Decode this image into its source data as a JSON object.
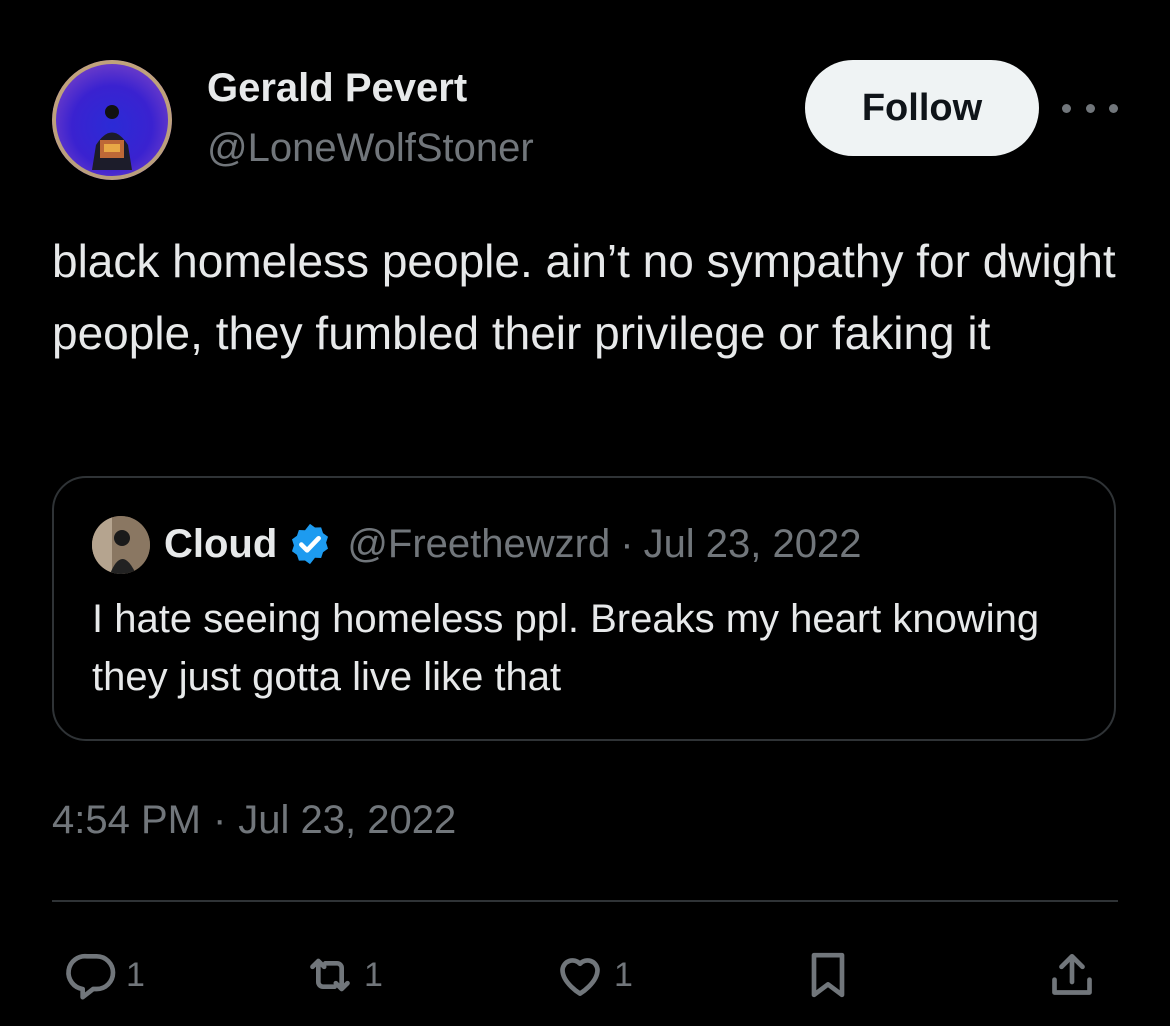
{
  "author": {
    "display_name": "Gerald Pevert",
    "handle": "@LoneWolfStoner"
  },
  "header": {
    "follow_label": "Follow",
    "more_icon": "more-horizontal-icon"
  },
  "tweet": {
    "text": "black homeless people. ain’t no sympathy for dwight people, they fumbled their privilege or faking it",
    "time": "4:54 PM",
    "separator": "·",
    "date": "Jul 23, 2022"
  },
  "quote": {
    "display_name": "Cloud",
    "verified_icon": "verified-badge-icon",
    "handle": "@Freethewzrd",
    "separator": "·",
    "date": "Jul 23, 2022",
    "text": "I hate seeing homeless ppl. Breaks my heart knowing they just gotta live like that"
  },
  "actions": {
    "reply_count": "1",
    "retweet_count": "1",
    "like_count": "1"
  },
  "colors": {
    "background": "#000000",
    "text_primary": "#e7e9ea",
    "text_secondary": "#71767b",
    "border": "#2f3336",
    "follow_bg": "#eff3f4",
    "verified": "#1d9bf0"
  }
}
